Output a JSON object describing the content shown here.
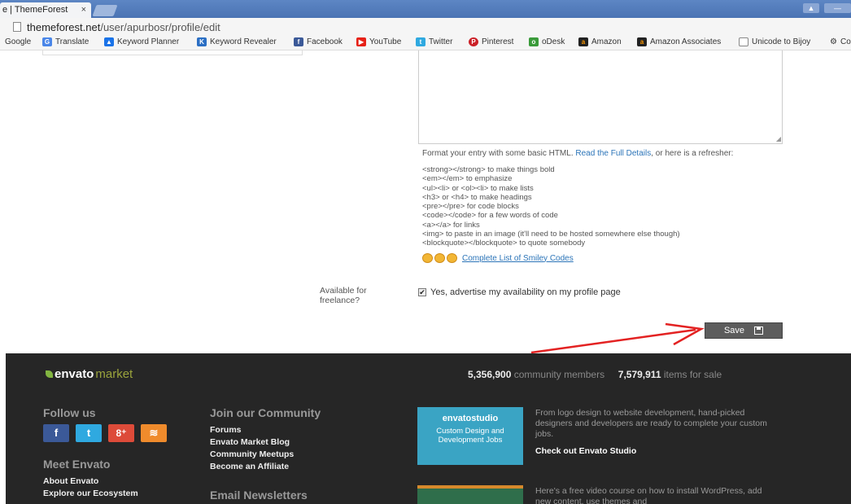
{
  "browser": {
    "tab_title": "e | ThemeForest",
    "tab_close": "×",
    "url_host": "themeforest.net",
    "url_path": "/user/apurbosr/profile/edit",
    "bookmarks": [
      {
        "label": "Google",
        "icon": "google-icon"
      },
      {
        "label": "Translate",
        "icon": "translate-icon"
      },
      {
        "label": "Keyword Planner",
        "icon": "keyword-planner-icon"
      },
      {
        "label": "Keyword Revealer",
        "icon": "keyword-revealer-icon"
      },
      {
        "label": "Facebook",
        "icon": "facebook-icon"
      },
      {
        "label": "YouTube",
        "icon": "youtube-icon"
      },
      {
        "label": "Twitter",
        "icon": "twitter-icon"
      },
      {
        "label": "Pinterest",
        "icon": "pinterest-icon"
      },
      {
        "label": "oDesk",
        "icon": "odesk-icon"
      },
      {
        "label": "Amazon",
        "icon": "amazon-icon"
      },
      {
        "label": "Amazon Associates",
        "icon": "amazon-icon"
      },
      {
        "label": "Unicode to Bijoy",
        "icon": "page-icon"
      },
      {
        "label": "Co",
        "icon": "gear-icon"
      }
    ]
  },
  "form": {
    "help_prefix": "Format your entry with some basic HTML.",
    "help_link": "Read the Full Details",
    "help_suffix": ", or here is a refresher:",
    "tags": [
      "<strong></strong> to make things bold",
      "<em></em> to emphasize",
      "<ul><li> or <ol><li> to make lists",
      "<h3> or <h4> to make headings",
      "<pre></pre> for code blocks",
      "<code></code> for a few words of code",
      "<a></a> for links",
      "<img> to paste in an image (it'll need to be hosted somewhere else though)",
      "<blockquote></blockquote> to quote somebody"
    ],
    "smiley_link": "Complete List of Smiley Codes",
    "freelance_label": "Available for freelance?",
    "freelance_checkbox": "Yes, advertise my availability on my profile page",
    "freelance_checked": true,
    "save_label": "Save"
  },
  "footer": {
    "logo_main": "envato",
    "logo_sub": "market",
    "members_count": "5,356,900",
    "members_label": "community members",
    "items_count": "7,579,911",
    "items_label": "items for sale",
    "follow_heading": "Follow us",
    "social": [
      {
        "glyph": "f",
        "name": "facebook",
        "color": "#3b5998"
      },
      {
        "glyph": "t",
        "name": "twitter",
        "color": "#2fa9e0"
      },
      {
        "glyph": "8⁺",
        "name": "google-plus",
        "color": "#dd4b39"
      },
      {
        "glyph": "≋",
        "name": "rss",
        "color": "#ef8b2c"
      }
    ],
    "meet_heading": "Meet Envato",
    "meet_links": [
      "About Envato",
      "Explore our Ecosystem"
    ],
    "community_heading": "Join our Community",
    "community_links": [
      "Forums",
      "Envato Market Blog",
      "Community Meetups",
      "Become an Affiliate"
    ],
    "newsletter_heading": "Email Newsletters",
    "studio_logo": "envatostudio",
    "studio_title": "Custom Design and Development Jobs",
    "studio_text": "From logo design to website development, hand-picked designers and developers are ready to complete your custom jobs.",
    "studio_cta": "Check out Envato Studio",
    "course_text": "Here's a free video course on how to install WordPress, add new content, use themes and"
  }
}
